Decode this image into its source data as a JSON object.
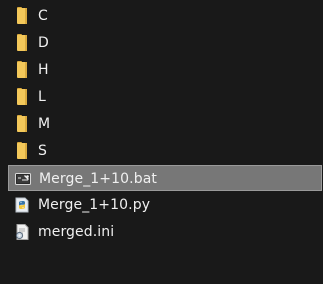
{
  "window": {
    "title": ""
  },
  "items": [
    {
      "name": "C",
      "type": "folder",
      "icon": "folder-icon"
    },
    {
      "name": "D",
      "type": "folder",
      "icon": "folder-icon"
    },
    {
      "name": "H",
      "type": "folder",
      "icon": "folder-icon"
    },
    {
      "name": "L",
      "type": "folder",
      "icon": "folder-icon"
    },
    {
      "name": "M",
      "type": "folder",
      "icon": "folder-icon"
    },
    {
      "name": "S",
      "type": "folder",
      "icon": "folder-icon"
    },
    {
      "name": "Merge_1+10.bat",
      "type": "batch-file",
      "icon": "batch-file-icon",
      "selected": true
    },
    {
      "name": "Merge_1+10.py",
      "type": "python-file",
      "icon": "python-file-icon"
    },
    {
      "name": "merged.ini",
      "type": "ini-file",
      "icon": "settings-file-icon"
    }
  ],
  "colors": {
    "background": "#191919",
    "selection": "#777777",
    "selection_border": "#9a9a9a",
    "text": "#f0f0f0",
    "folder": "#f3c85a"
  }
}
